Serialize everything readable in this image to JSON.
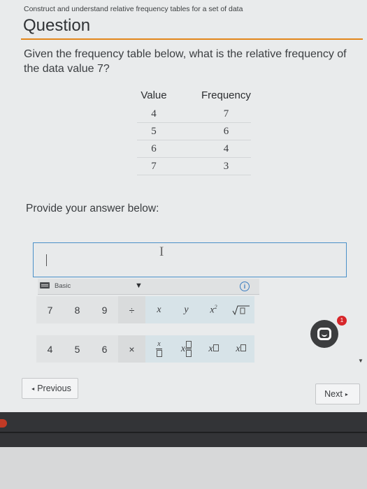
{
  "header": {
    "topic": "Construct and understand relative frequency tables for a set of data",
    "title": "Question"
  },
  "question": {
    "text": "Given the frequency table below, what is the relative frequency of the data value 7?"
  },
  "table": {
    "headers": [
      "Value",
      "Frequency"
    ],
    "rows": [
      {
        "value": "4",
        "frequency": "7"
      },
      {
        "value": "5",
        "frequency": "6"
      },
      {
        "value": "6",
        "frequency": "4"
      },
      {
        "value": "7",
        "frequency": "3"
      }
    ]
  },
  "answer": {
    "prompt": "Provide your answer below:",
    "value": ""
  },
  "keyboard": {
    "mode_label": "Basic",
    "info_label": "i",
    "keys_row1": [
      "7",
      "8",
      "9",
      "÷"
    ],
    "keys_row2": [
      "4",
      "5",
      "6",
      "×"
    ],
    "math_row1": [
      "x",
      "y"
    ],
    "math_row2_labels": [
      "x",
      "x",
      "x"
    ]
  },
  "chat": {
    "badge": "1"
  },
  "nav": {
    "previous_label": "Previous",
    "next_label": "Next"
  },
  "colors": {
    "accent": "#e2861b",
    "input_border": "#4a90c8",
    "badge": "#d7262a"
  }
}
